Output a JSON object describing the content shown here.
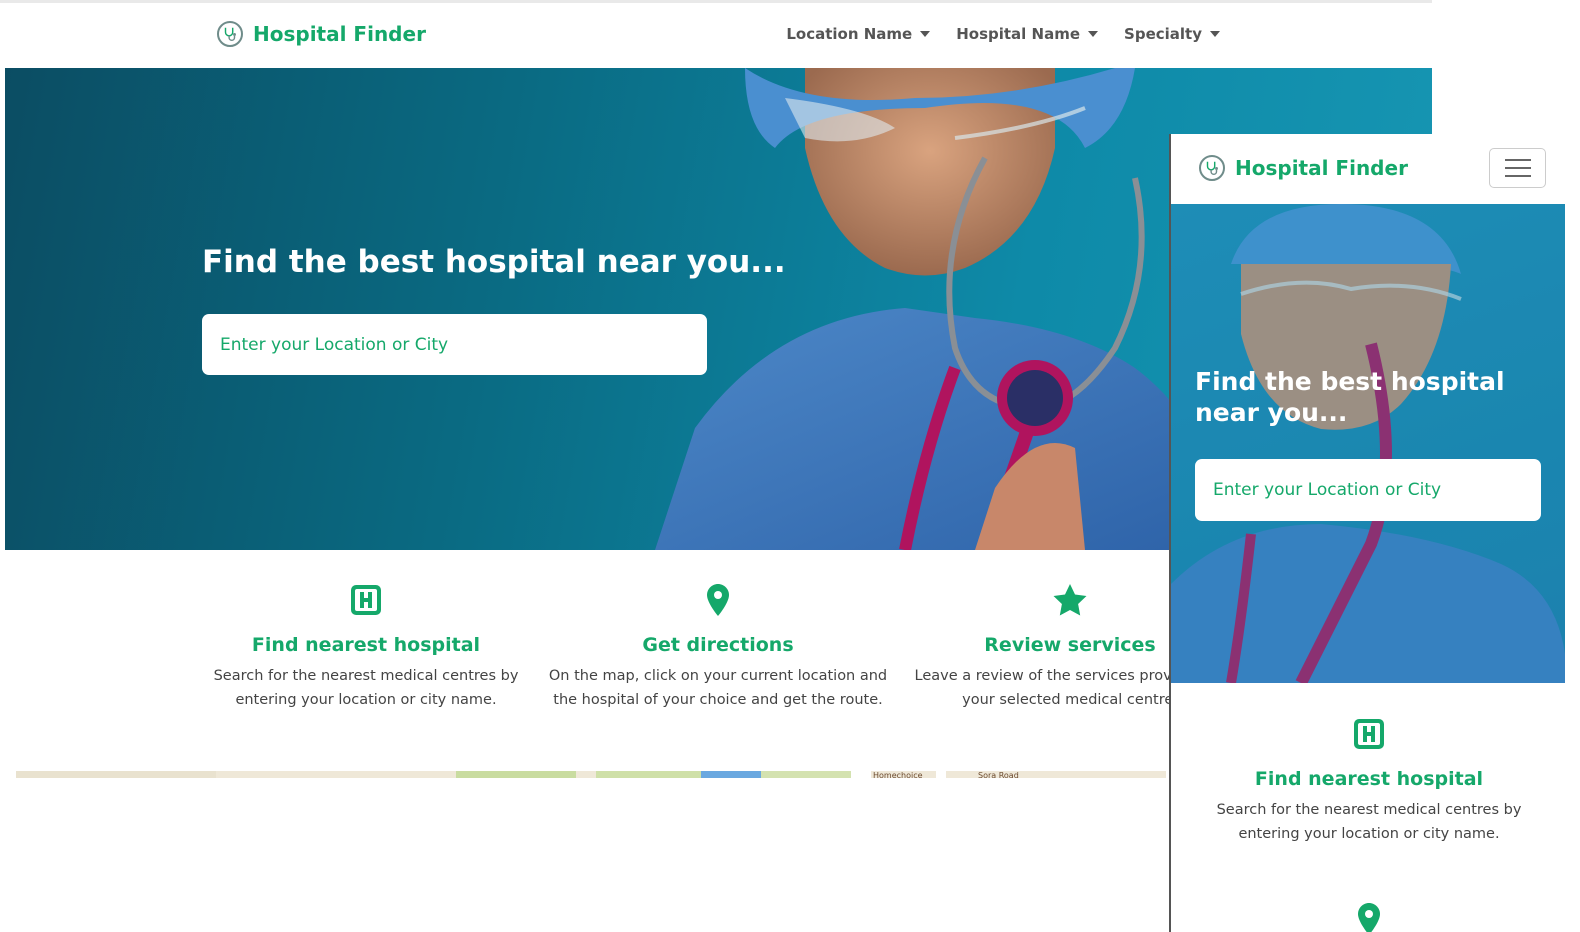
{
  "brand": {
    "name": "Hospital Finder",
    "color": "#15a86a"
  },
  "nav": {
    "items": [
      {
        "label": "Location Name"
      },
      {
        "label": "Hospital Name"
      },
      {
        "label": "Specialty"
      }
    ]
  },
  "hero": {
    "title": "Find the best hospital near you...",
    "search_placeholder": "Enter your Location or City"
  },
  "features": [
    {
      "icon": "hospital-icon",
      "title": "Find nearest hospital",
      "text": "Search for the nearest medical centres by entering your location or city name."
    },
    {
      "icon": "map-pin-icon",
      "title": "Get directions",
      "text": "On the map, click on your current location and the hospital of your choice and get the route."
    },
    {
      "icon": "star-icon",
      "title": "Review services",
      "text": "Leave a review of the services provided by your selected medical centre."
    }
  ],
  "map": {
    "labels": [
      "Homechoice",
      "Sora Road"
    ]
  },
  "mobile": {
    "brand": "Hospital Finder",
    "hero_title": "Find the best hospital near you...",
    "search_placeholder": "Enter your Location or City",
    "features": [
      {
        "icon": "hospital-icon",
        "title": "Find nearest hospital",
        "text": "Search for the nearest medical centres by entering your location or city name."
      },
      {
        "icon": "map-pin-icon"
      }
    ]
  }
}
